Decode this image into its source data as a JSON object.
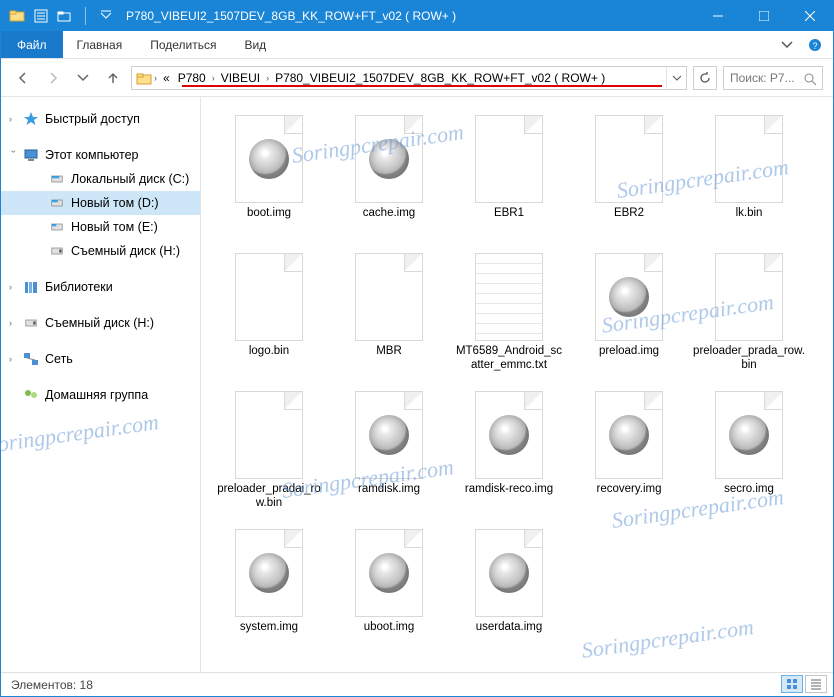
{
  "titlebar": {
    "title": "P780_VIBEUI2_1507DEV_8GB_KK_ROW+FT_v02 ( ROW+ )"
  },
  "ribbon": {
    "file": "Файл",
    "tabs": [
      "Главная",
      "Поделиться",
      "Вид"
    ]
  },
  "address": {
    "crumbs": [
      "«",
      "P780",
      "VIBEUI",
      "P780_VIBEUI2_1507DEV_8GB_KK_ROW+FT_v02 ( ROW+ )"
    ],
    "search_placeholder": "Поиск: P7..."
  },
  "nav": {
    "quick": "Быстрый доступ",
    "thispc": "Этот компьютер",
    "drives": [
      "Локальный диск (C:)",
      "Новый том (D:)",
      "Новый том (E:)",
      "Съемный диск (H:)"
    ],
    "libraries": "Библиотеки",
    "removable": "Съемный диск (H:)",
    "network": "Сеть",
    "homegroup": "Домашняя группа"
  },
  "files": [
    {
      "name": "boot.img",
      "type": "disc"
    },
    {
      "name": "cache.img",
      "type": "disc"
    },
    {
      "name": "EBR1",
      "type": "blank"
    },
    {
      "name": "EBR2",
      "type": "blank"
    },
    {
      "name": "lk.bin",
      "type": "blank"
    },
    {
      "name": "logo.bin",
      "type": "blank"
    },
    {
      "name": "MBR",
      "type": "blank"
    },
    {
      "name": "MT6589_Android_scatter_emmc.txt",
      "type": "text"
    },
    {
      "name": "preload.img",
      "type": "disc"
    },
    {
      "name": "preloader_prada_row.bin",
      "type": "blank"
    },
    {
      "name": "preloader_pradai_row.bin",
      "type": "blank"
    },
    {
      "name": "ramdisk.img",
      "type": "disc"
    },
    {
      "name": "ramdisk-reco.img",
      "type": "disc"
    },
    {
      "name": "recovery.img",
      "type": "disc"
    },
    {
      "name": "secro.img",
      "type": "disc"
    },
    {
      "name": "system.img",
      "type": "disc"
    },
    {
      "name": "uboot.img",
      "type": "disc"
    },
    {
      "name": "userdata.img",
      "type": "disc"
    }
  ],
  "status": {
    "count_label": "Элементов:",
    "count": "18"
  },
  "watermark": "Soringpcrepair.com"
}
